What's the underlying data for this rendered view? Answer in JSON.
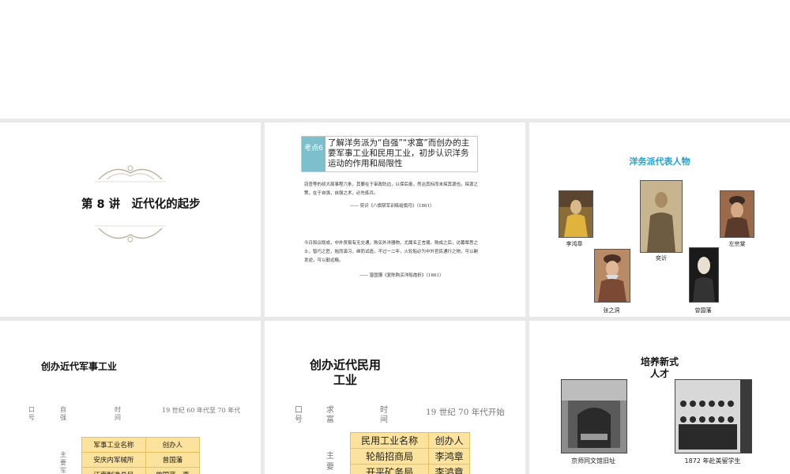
{
  "slide1": {
    "title": "第 8 讲　近代化的起步"
  },
  "slide2": {
    "tag": "考点6",
    "objective": "了解洋务派为“自强”“求富”而创办的主要军事工业和民用工业，初步认识洋务运动的作用和局限性",
    "quote1": "窃查等的叔大局事程六条，其要在于审政防边，以保后患，然治其标而未探其源也。探源之策，在于自强，自强之术，必先练兵。",
    "quote1_source": "—— 奕䜣《八旗禁军训练给旗月》（1861）",
    "quote2": "今日和议既成，中外贸易有无交通，购买外洋器物，尤属名正言顺。购成之后，访募覃思之士，智巧之匠，始而演习，继而试造，不过一二年，火轮船必为中外官民通行之物，可以剿发逆，可以勤远略。",
    "quote2_source": "—— 曾国藩《复陈购买洋船炮折》（1861）"
  },
  "slide3": {
    "title": "洋务派代表人物",
    "title_color": "#1aa3d8",
    "people": [
      "李鸿章",
      "奕䜣",
      "左宗棠",
      "张之洞",
      "曾国藩"
    ]
  },
  "slide4": {
    "title": "创办近代军事工业",
    "slogan_label": "口号",
    "slogan_value": "自强",
    "time_label": "时间",
    "time_value": "19 世纪 60 年代至 70 年代",
    "main_label": "主要军",
    "table_headers": [
      "军事工业名称",
      "创办人"
    ],
    "table_rows": [
      [
        "安庆内军械所",
        "曾国藩"
      ],
      [
        "江南制造总局",
        "曾国藩、李"
      ]
    ]
  },
  "slide5": {
    "title": "创办近代民用工业",
    "slogan_label": "口号",
    "slogan_value": "求富",
    "time_label": "时间",
    "time_value": "19 世纪 70 年代开始",
    "main_label": "主要",
    "table_headers": [
      "民用工业名称",
      "创办人"
    ],
    "table_rows": [
      [
        "轮船招商局",
        "李鸿章"
      ],
      [
        "开平矿务局",
        "李鸿章"
      ]
    ]
  },
  "slide6": {
    "title": "培养新式人才",
    "photo1_caption": "京师同文馆旧址",
    "photo2_caption": "1872 年赴美留学生"
  }
}
